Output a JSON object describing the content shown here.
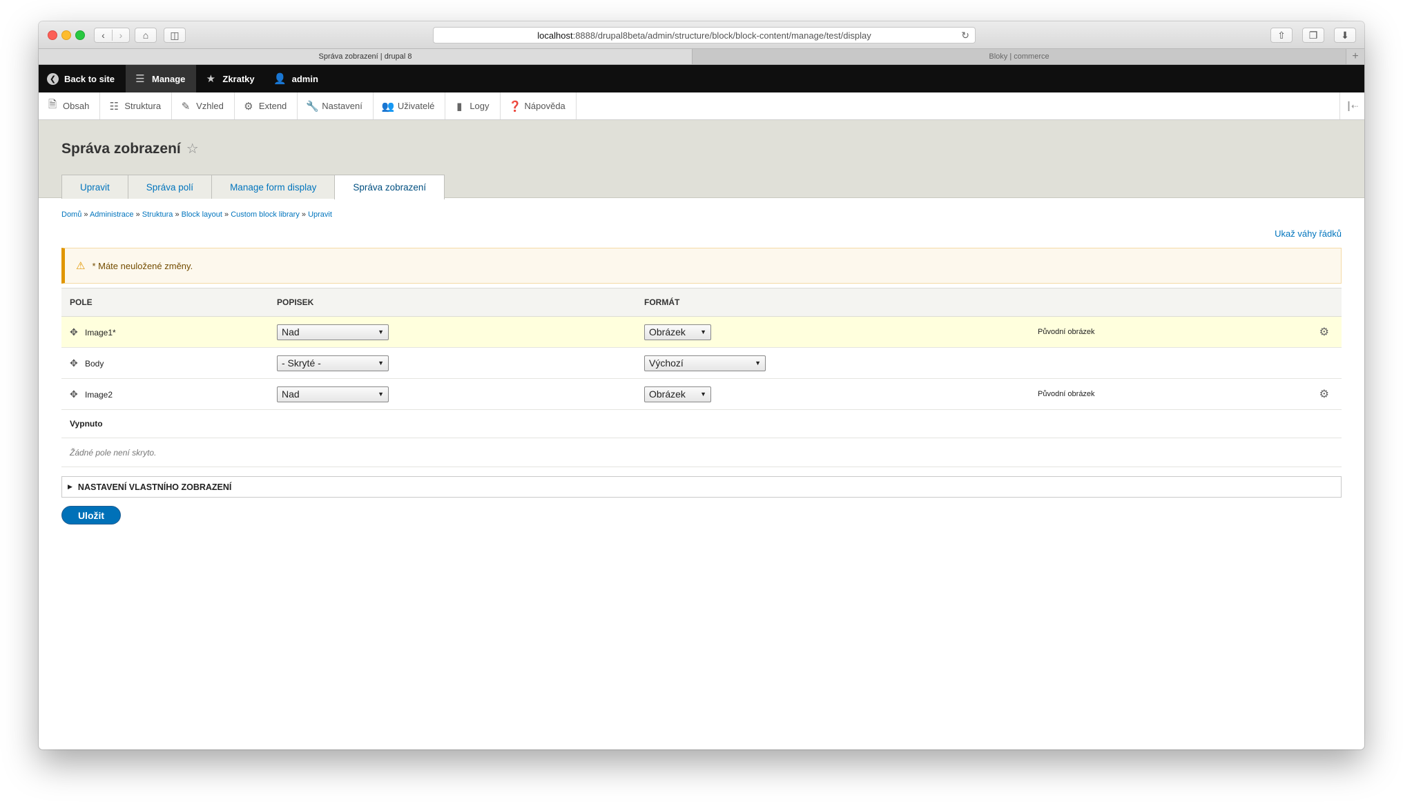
{
  "browser": {
    "url_host": "localhost",
    "url_rest": ":8888/drupal8beta/admin/structure/block/block-content/manage/test/display",
    "tabs": [
      {
        "label": "Správa zobrazení | drupal 8",
        "active": true
      },
      {
        "label": "Bloky | commerce",
        "active": false
      }
    ],
    "reload_icon": "↻",
    "add_tab_icon": "+"
  },
  "admin_bar": {
    "back": "Back to site",
    "manage": "Manage",
    "shortcuts": "Zkratky",
    "user": "admin"
  },
  "tray": {
    "items": [
      "Obsah",
      "Struktura",
      "Vzhled",
      "Extend",
      "Nastavení",
      "Uživatelé",
      "Logy",
      "Nápověda"
    ]
  },
  "page": {
    "title": "Správa zobrazení",
    "tabs": [
      {
        "label": "Upravit",
        "active": false
      },
      {
        "label": "Správa polí",
        "active": false
      },
      {
        "label": "Manage form display",
        "active": false
      },
      {
        "label": "Správa zobrazení",
        "active": true
      }
    ]
  },
  "breadcrumb": [
    "Domů",
    "Administrace",
    "Struktura",
    "Block layout",
    "Custom block library",
    "Upravit"
  ],
  "weights_link": "Ukaž váhy řádků",
  "warning": "* Máte neuložené změny.",
  "table": {
    "headers": [
      "POLE",
      "POPISEK",
      "FORMÁT"
    ],
    "rows": [
      {
        "field": "Image1*",
        "label": "Nad",
        "format": "Obrázek",
        "summary": "Původní obrázek",
        "changed": true
      },
      {
        "field": "Body",
        "label": "- Skryté -",
        "format": "Výchozí",
        "summary": "",
        "changed": false
      },
      {
        "field": "Image2",
        "label": "Nad",
        "format": "Obrázek",
        "summary": "Původní obrázek",
        "changed": false
      }
    ],
    "disabled_region": "Vypnuto",
    "empty_text": "Žádné pole není skryto."
  },
  "details_label": "NASTAVENÍ VLASTNÍHO ZOBRAZENÍ",
  "save_label": "Uložit",
  "colors": {
    "link": "#0074bd",
    "admin_bar": "#0f0f0f",
    "save_button": "#0071b8",
    "warning_border": "#e09600"
  }
}
